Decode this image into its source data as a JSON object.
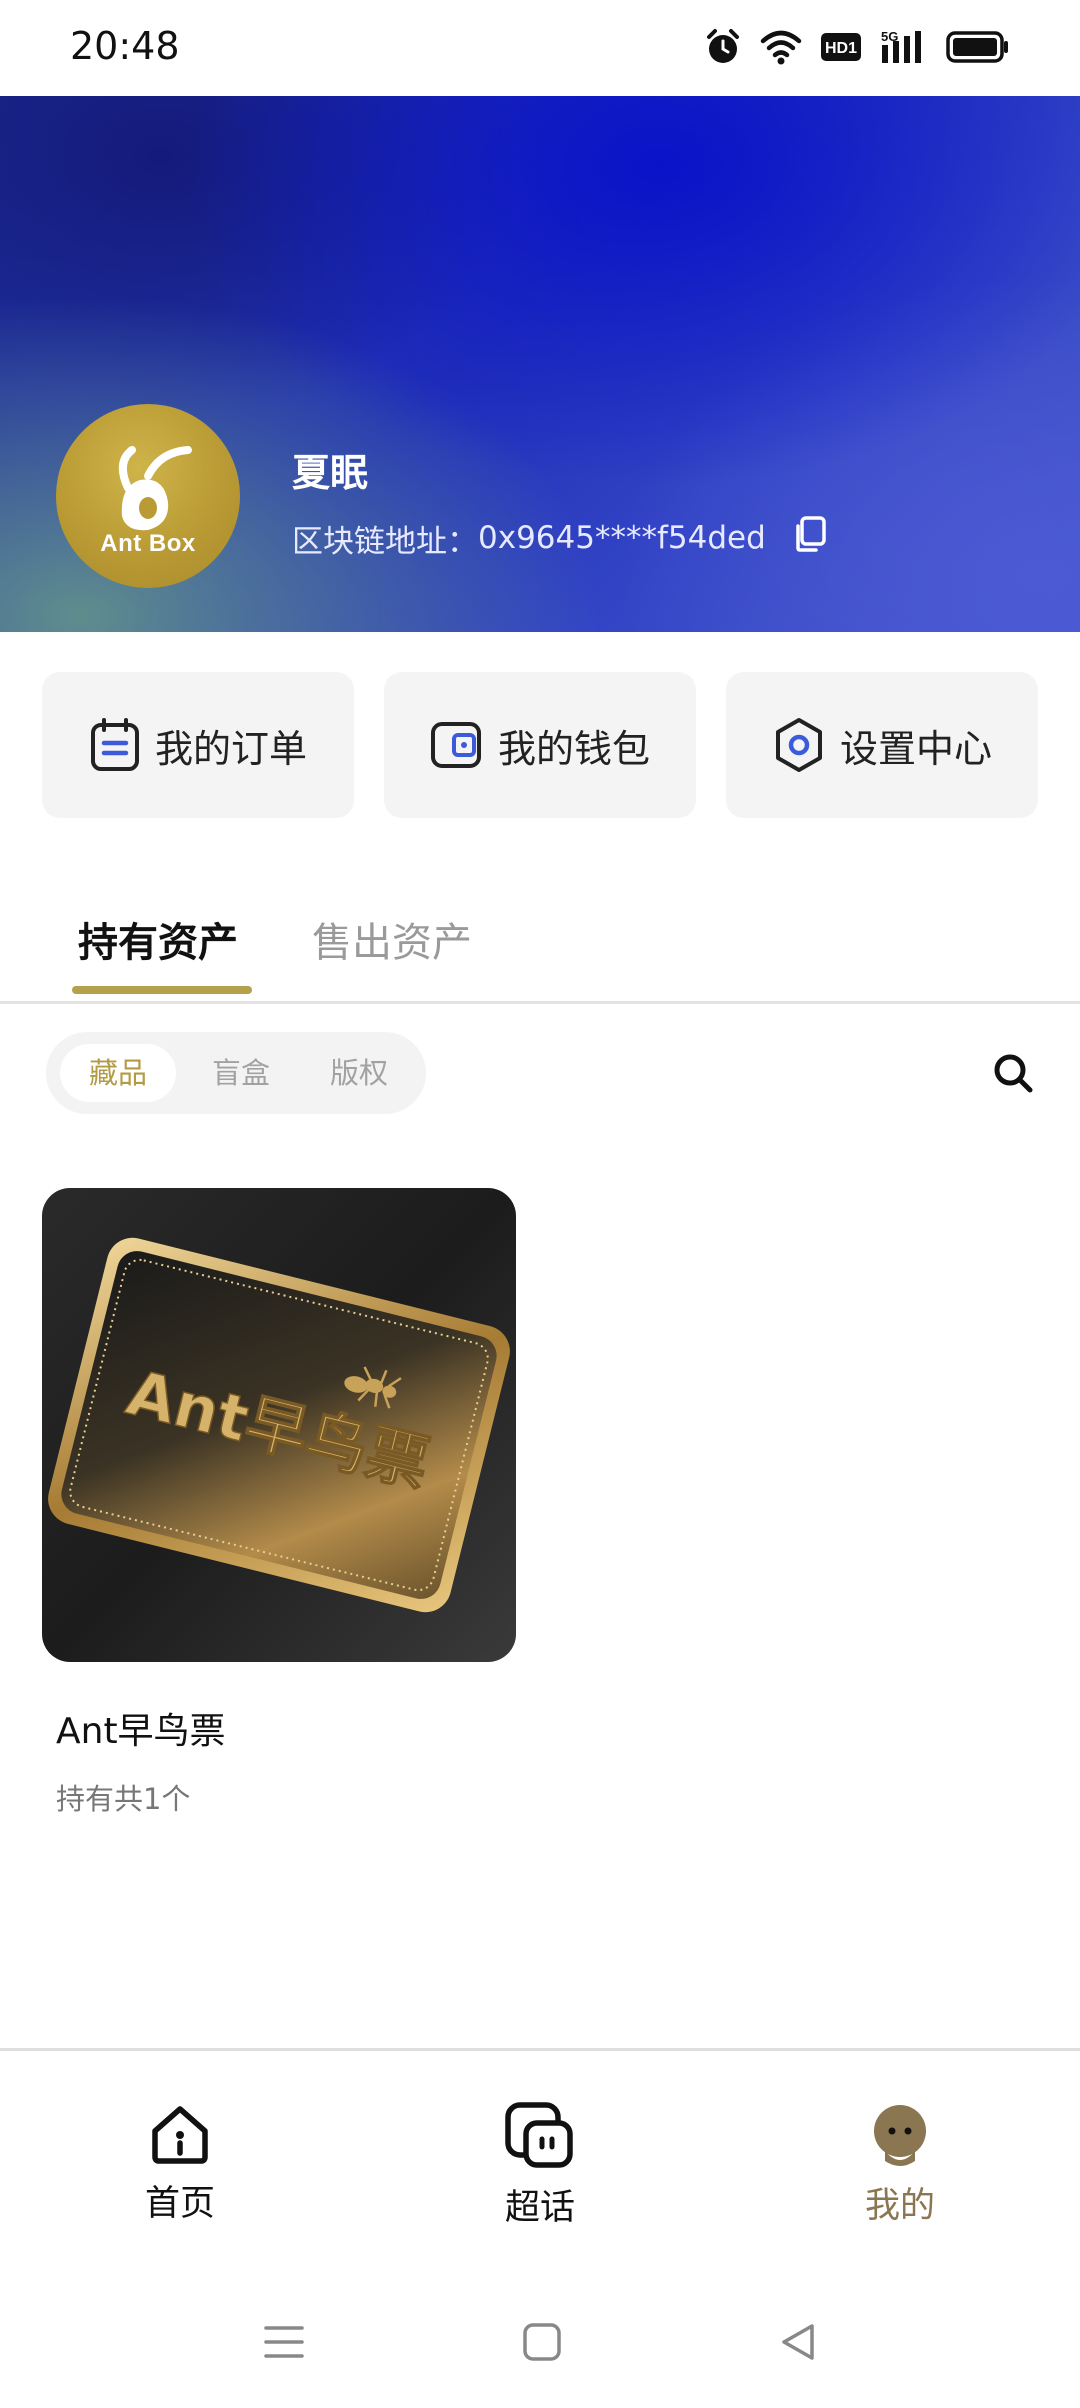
{
  "status_bar": {
    "time": "20:48",
    "icons": [
      "alarm-icon",
      "wifi-icon",
      "hd-icon",
      "5g-signal-icon",
      "battery-icon"
    ],
    "hd_text": "HD1",
    "network_text": "5G"
  },
  "profile": {
    "avatar_text": "Ant Box",
    "username": "夏眠",
    "address_label": "区块链地址：",
    "address_value": "0x9645****f54ded"
  },
  "quick_actions": [
    {
      "label": "我的订单",
      "icon": "order-icon"
    },
    {
      "label": "我的钱包",
      "icon": "wallet-icon"
    },
    {
      "label": "设置中心",
      "icon": "settings-icon"
    }
  ],
  "asset_tabs": {
    "held": "持有资产",
    "sold": "售出资产",
    "active": "held"
  },
  "categories": {
    "items": [
      "藏品",
      "盲盒",
      "版权"
    ],
    "active": "藏品"
  },
  "assets": [
    {
      "title": "Ant早鸟票",
      "count_text": "持有共1个",
      "image_text": "Ant早鸟票"
    }
  ],
  "bottom_nav": {
    "items": [
      {
        "label": "首页",
        "icon": "home-icon"
      },
      {
        "label": "超话",
        "icon": "topic-icon"
      },
      {
        "label": "我的",
        "icon": "profile-icon"
      }
    ],
    "active": "我的"
  },
  "colors": {
    "accent_gold": "#b5a14b",
    "mine_active": "#8a7650",
    "icon_blue": "#3b5bdb"
  }
}
